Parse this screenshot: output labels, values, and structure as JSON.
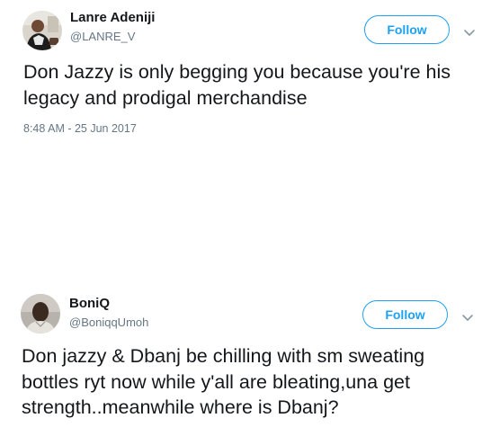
{
  "colors": {
    "accent": "#1da1f2",
    "text": "#14171a",
    "secondary_text": "#657786"
  },
  "tweets": [
    {
      "author": {
        "display_name": "Lanre Adeniji",
        "handle": "@LANRE_V"
      },
      "follow_label": "Follow",
      "text": "Don Jazzy is only begging you because you're his legacy and prodigal merchandise",
      "timestamp": "8:48 AM - 25 Jun 2017",
      "menu_icon": "chevron-down-icon"
    },
    {
      "author": {
        "display_name": "BoniQ",
        "handle": "@BoniqqUmoh"
      },
      "follow_label": "Follow",
      "text": "Don jazzy & Dbanj be chilling with sm sweating bottles ryt now while y'all are bleating,una get strength..meanwhile where is Dbanj?",
      "menu_icon": "chevron-down-icon"
    }
  ]
}
